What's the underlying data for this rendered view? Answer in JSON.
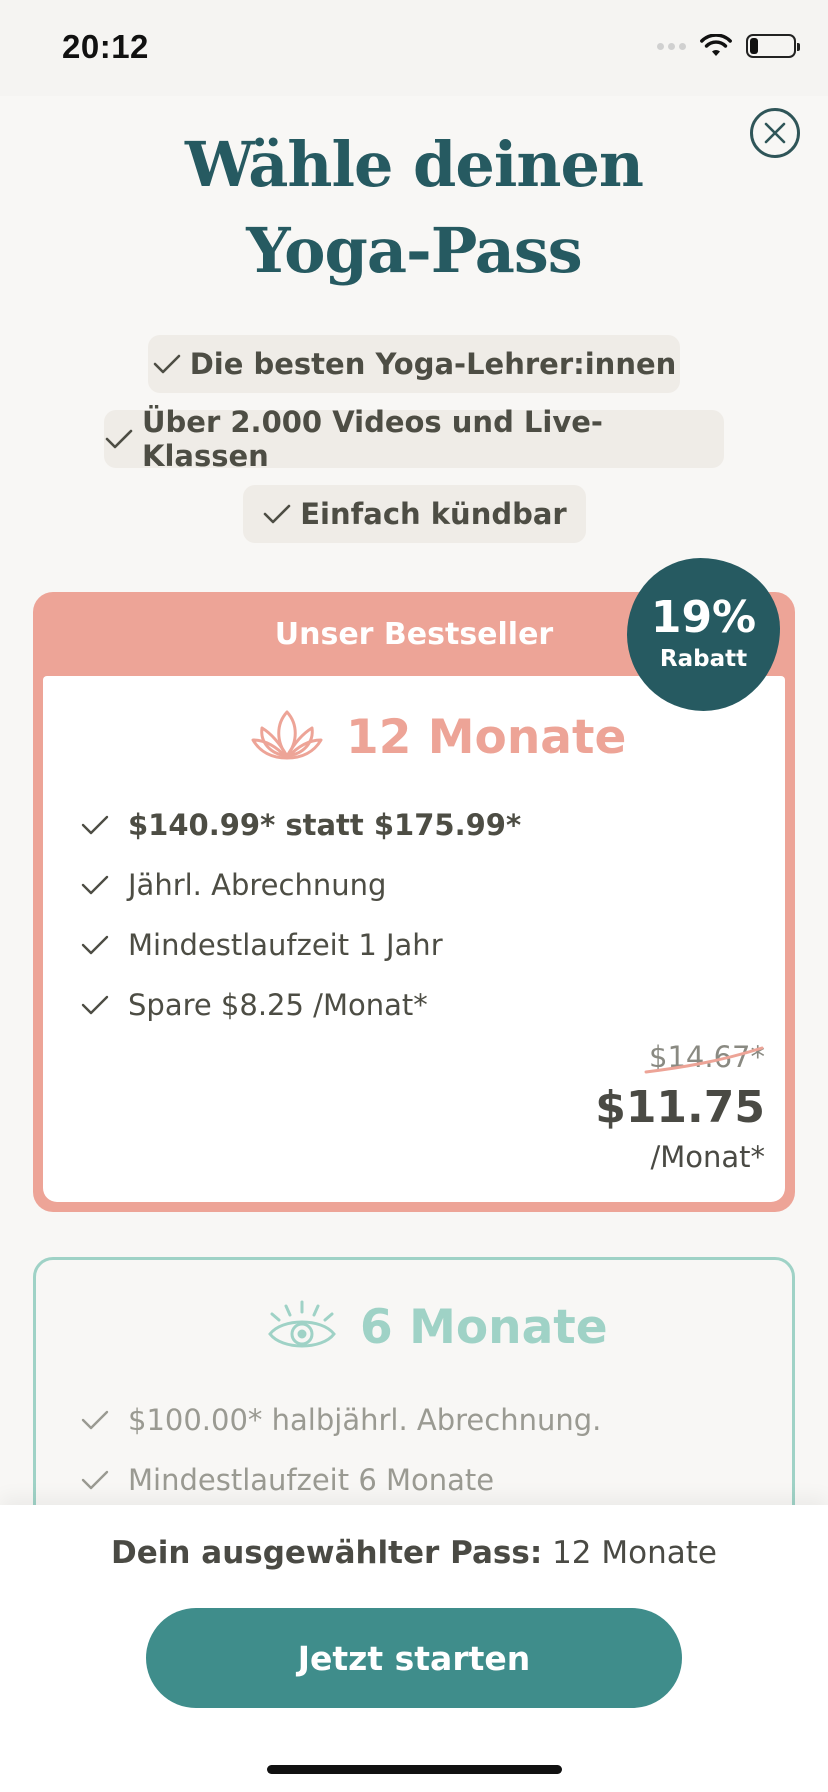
{
  "status_bar": {
    "time": "20:12",
    "battery_level": 0.2
  },
  "title": {
    "line1": "Wähle deinen",
    "line2": "Yoga-Pass"
  },
  "benefits": [
    "Die besten Yoga-Lehrer:innen",
    "Über 2.000 Videos und Live-Klassen",
    "Einfach kündbar"
  ],
  "plans": {
    "best": {
      "header": "Unser Bestseller",
      "badge_percent": "19%",
      "badge_label": "Rabatt",
      "name": "12 Monate",
      "features": [
        "$140.99* statt $175.99*",
        "Jährl. Abrechnung",
        "Mindestlaufzeit 1 Jahr",
        "Spare $8.25 /Monat*"
      ],
      "old_price": "$14.67*",
      "price": "$11.75",
      "per": "/Monat*"
    },
    "six": {
      "name": "6 Monate",
      "features": [
        "$100.00* halbjährl. Abrechnung.",
        "Mindestlaufzeit 6 Monate"
      ]
    }
  },
  "footer": {
    "selected_label": "Dein ausgewählter Pass:",
    "selected_value": "12 Monate",
    "cta": "Jetzt starten"
  },
  "colors": {
    "title": "#265a61",
    "salmon": "#eda497",
    "mint": "#9fd2c6",
    "cta": "#3f8d8b"
  },
  "icons": {
    "close": "close-icon",
    "check": "check-icon",
    "lotus": "lotus-icon",
    "eye": "eye-icon",
    "wifi": "wifi-icon",
    "battery": "battery-icon"
  }
}
